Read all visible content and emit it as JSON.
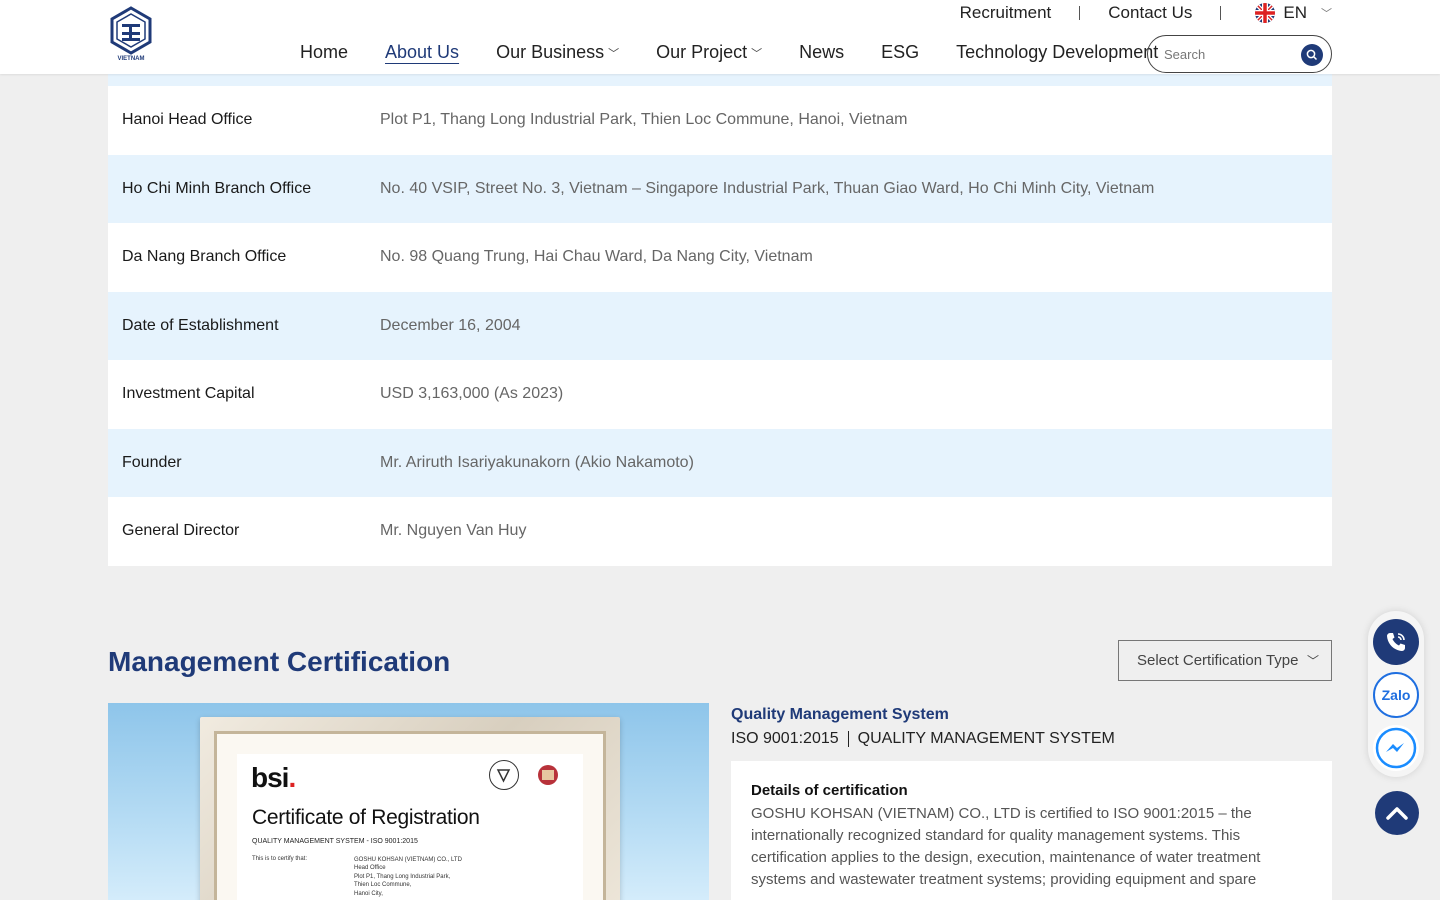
{
  "header": {
    "logo_text": "VIETNAM",
    "top_links": [
      "Recruitment",
      "Contact Us"
    ],
    "language": "EN",
    "nav": [
      {
        "label": "Home",
        "has_dropdown": false,
        "active": false
      },
      {
        "label": "About Us",
        "has_dropdown": false,
        "active": true
      },
      {
        "label": "Our Business",
        "has_dropdown": true,
        "active": false
      },
      {
        "label": "Our Project",
        "has_dropdown": true,
        "active": false
      },
      {
        "label": "News",
        "has_dropdown": false,
        "active": false
      },
      {
        "label": "ESG",
        "has_dropdown": false,
        "active": false
      },
      {
        "label": "Technology Development",
        "has_dropdown": false,
        "active": false
      }
    ],
    "search_placeholder": "Search"
  },
  "company_info": [
    {
      "label": "Hanoi Head Office",
      "value": "Plot P1, Thang Long Industrial Park, Thien Loc Commune, Hanoi, Vietnam"
    },
    {
      "label": "Ho Chi Minh Branch Office",
      "value": "No. 40 VSIP, Street No. 3, Vietnam – Singapore Industrial Park, Thuan Giao Ward, Ho Chi Minh City, Vietnam"
    },
    {
      "label": "Da Nang Branch Office",
      "value": "No. 98 Quang Trung, Hai Chau Ward, Da Nang City, Vietnam"
    },
    {
      "label": "Date of Establishment",
      "value": "December 16, 2004"
    },
    {
      "label": "Investment Capital",
      "value": "USD 3,163,000 (As 2023)"
    },
    {
      "label": "Founder",
      "value": "Mr. Ariruth Isariyakunakorn (Akio Nakamoto)"
    },
    {
      "label": "General Director",
      "value": "Mr. Nguyen Van Huy"
    }
  ],
  "certification": {
    "title": "Management Certification",
    "select_label": "Select Certification Type",
    "category": "Quality Management System",
    "standard_code": "ISO 9001:2015",
    "standard_name": "QUALITY MANAGEMENT SYSTEM",
    "details_title": "Details of certification",
    "details_text": "GOSHU KOHSAN (VIETNAM) CO., LTD is certified to ISO 9001:2015 – the internationally recognized standard for quality management systems. This certification applies to the design, execution, maintenance of water treatment systems and wastewater treatment systems; providing equipment and spare",
    "image": {
      "brand": "bsi",
      "heading": "Certificate of Registration",
      "subheading": "QUALITY MANAGEMENT SYSTEM - ISO 9001:2015",
      "certify_label": "This is to certify that:",
      "company_lines": [
        "GOSHU KOHSAN (VIETNAM) CO., LTD",
        "Head Office",
        "Plot P1, Thang Long Industrial Park,",
        "Thien Loc Commune,",
        "Hanoi City,"
      ]
    }
  },
  "floating": {
    "buttons": [
      "phone-icon",
      "zalo-icon",
      "messenger-icon"
    ],
    "zalo_label": "Zalo",
    "accent": "#1f3a78"
  }
}
